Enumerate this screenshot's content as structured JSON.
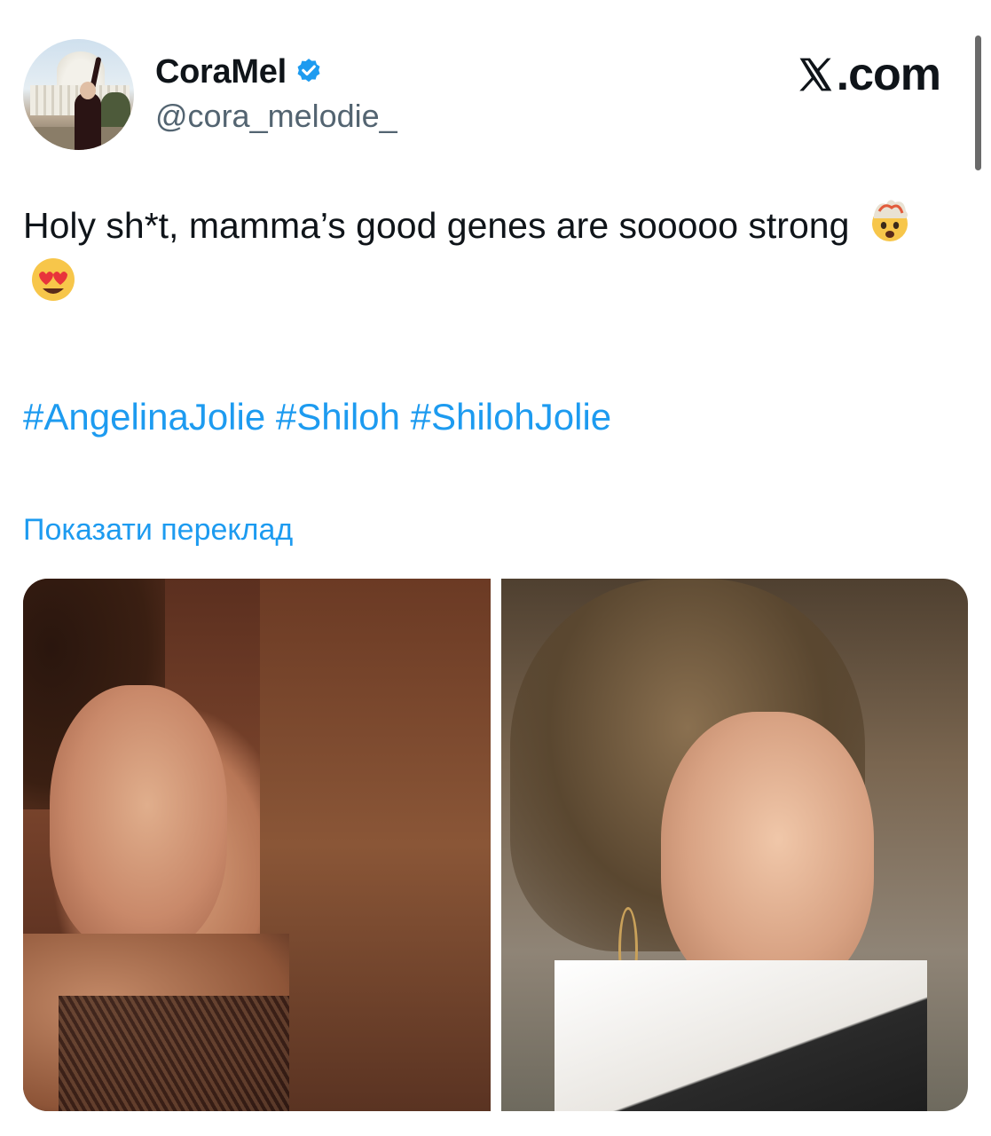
{
  "author": {
    "display_name": "CoraMel",
    "handle": "@cora_melodie_",
    "verified": true,
    "verified_icon": "verified-badge-icon"
  },
  "brand": {
    "label": ".com",
    "logo_icon": "x-logo-icon"
  },
  "tweet": {
    "text": "Holy sh*t, mamma’s good genes are sooooo strong",
    "emojis": [
      "🤯",
      "😍"
    ],
    "hashtags": [
      "#AngelinaJolie",
      "#Shiloh",
      "#ShilohJolie"
    ],
    "translate_label": "Показати переклад"
  },
  "media": {
    "count": 2
  },
  "colors": {
    "link": "#1d9bf0",
    "text": "#0f1419",
    "muted": "#536471",
    "verified": "#1d9bf0"
  }
}
